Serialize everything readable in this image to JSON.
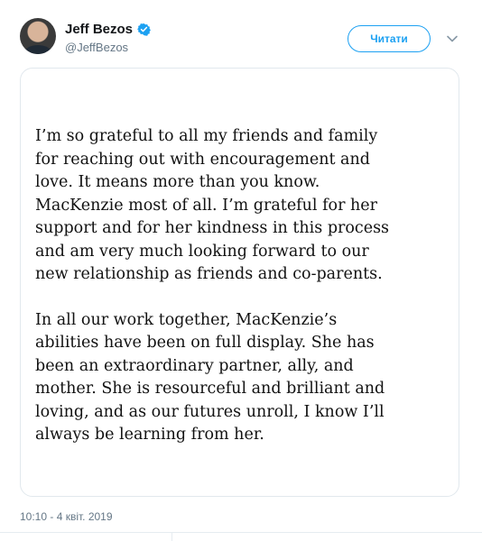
{
  "tweet": {
    "author": {
      "name": "Jeff Bezos",
      "handle": "@JeffBezos",
      "verified": true,
      "avatar": "profile-photo"
    },
    "follow_label": "Читати",
    "menu_icon": "chevron-down-icon",
    "image_text": {
      "paragraph_1": "I’m so grateful to all my friends and family\nfor reaching out with encouragement and\nlove. It means more than you know.\nMacKenzie most of all. I’m grateful for her\nsupport and for her kindness in this process\nand am very much looking forward to our\nnew relationship as friends and co-parents.",
      "paragraph_2": "In all our work together, MacKenzie’s\nabilities have been on full display. She has\nbeen an extraordinary partner, ally, and\nmother. She is resourceful and brilliant and\nloving, and as our futures unroll, I know I’ll\nalways be learning from her."
    },
    "timestamp": "10:10 - 4 квіт. 2019"
  },
  "colors": {
    "accent": "#1da1f2",
    "text_primary": "#14171a",
    "text_secondary": "#657786",
    "border": "#e1e8ed"
  }
}
